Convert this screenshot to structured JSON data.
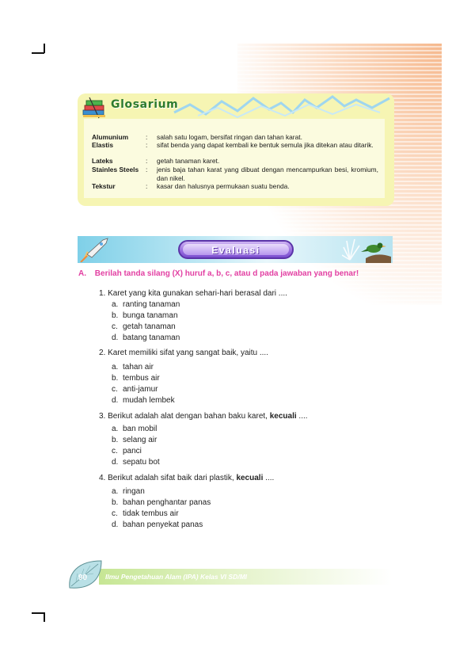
{
  "glossary": {
    "title": "Glosarium",
    "entries": [
      {
        "term": "Alumunium",
        "definition": "salah satu logam, bersifat ringan dan tahan karat."
      },
      {
        "term": "Elastis",
        "definition": "sifat benda yang dapat kembali ke bentuk semula jika ditekan atau ditarik."
      },
      {
        "term": "Lateks",
        "definition": "getah tanaman karet."
      },
      {
        "term": "Stainles Steels",
        "definition": "jenis baja tahan karat yang dibuat dengan mencampurkan besi, kromium, dan nikel."
      },
      {
        "term": "Tekstur",
        "definition": "kasar dan halusnya permukaan suatu benda."
      }
    ]
  },
  "evaluation": {
    "banner_title": "Evaluasi",
    "section": {
      "prefix": "A.",
      "instruction": "Berilah tanda silang (X) huruf a, b, c, atau d pada jawaban yang benar!"
    },
    "questions": [
      {
        "number": "1.",
        "text": "Karet yang kita gunakan sehari-hari berasal dari ....",
        "bold": "",
        "tail": "",
        "options": [
          {
            "letter": "a.",
            "text": "ranting tanaman"
          },
          {
            "letter": "b.",
            "text": "bunga tanaman"
          },
          {
            "letter": "c.",
            "text": "getah tanaman"
          },
          {
            "letter": "d.",
            "text": "batang tanaman"
          }
        ]
      },
      {
        "number": "2.",
        "text": "Karet memiliki sifat yang sangat baik, yaitu ....",
        "bold": "",
        "tail": "",
        "options": [
          {
            "letter": "a.",
            "text": "tahan air"
          },
          {
            "letter": "b.",
            "text": "tembus air"
          },
          {
            "letter": "c.",
            "text": "anti-jamur"
          },
          {
            "letter": "d.",
            "text": "mudah lembek"
          }
        ]
      },
      {
        "number": "3.",
        "text": "Berikut adalah alat dengan bahan baku karet, ",
        "bold": "kecuali",
        "tail": " ....",
        "options": [
          {
            "letter": "a.",
            "text": "ban mobil"
          },
          {
            "letter": "b.",
            "text": "selang air"
          },
          {
            "letter": "c.",
            "text": "panci"
          },
          {
            "letter": "d.",
            "text": "sepatu bot"
          }
        ]
      },
      {
        "number": "4.",
        "text": "Berikut adalah sifat baik dari plastik, ",
        "bold": "kecuali",
        "tail": " ....",
        "options": [
          {
            "letter": "a.",
            "text": "ringan"
          },
          {
            "letter": "b.",
            "text": "bahan penghantar panas"
          },
          {
            "letter": "c.",
            "text": "tidak tembus air"
          },
          {
            "letter": "d.",
            "text": "bahan penyekat panas"
          }
        ]
      }
    ]
  },
  "footer": {
    "page_number": "90",
    "book_title": "Ilmu Pengetahuan Alam (IPA) Kelas VI SD/MI"
  },
  "colors": {
    "accent_pink": "#e23fa2",
    "glossary_title_green": "#2e7b2e",
    "banner_purple": "#7b4fcf"
  }
}
